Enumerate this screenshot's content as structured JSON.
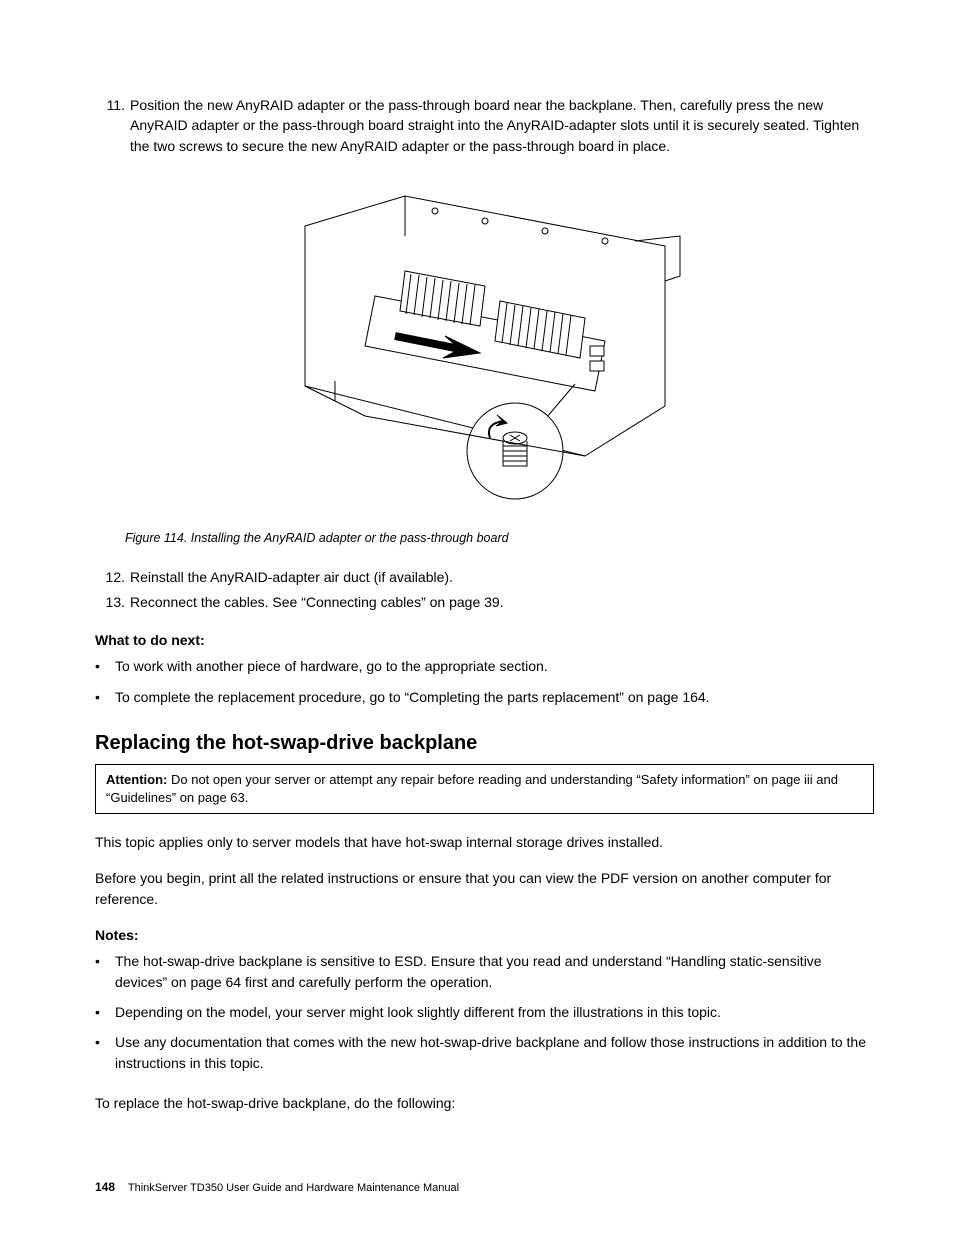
{
  "steps_a": [
    {
      "num": "11.",
      "text": "Position the new AnyRAID adapter or the pass-through board near the backplane. Then, carefully press the new AnyRAID adapter or the pass-through board straight into the AnyRAID-adapter slots until it is securely seated. Tighten the two screws to secure the new AnyRAID adapter or the pass-through board in place."
    }
  ],
  "figure_caption": "Figure 114. Installing the AnyRAID adapter or the pass-through board",
  "steps_b": [
    {
      "num": "12.",
      "text": "Reinstall the AnyRAID-adapter air duct (if available)."
    },
    {
      "num": "13.",
      "text": "Reconnect the cables. See “Connecting cables” on page 39."
    }
  ],
  "what_next_header": "What to do next:",
  "what_next_items": [
    "To work with another piece of hardware, go to the appropriate section.",
    "To complete the replacement procedure, go to “Completing the parts replacement” on page 164."
  ],
  "section_heading": "Replacing the hot-swap-drive backplane",
  "attention_label": "Attention:",
  "attention_text": " Do not open your server or attempt any repair before reading and understanding “Safety information” on page iii and “Guidelines” on page 63.",
  "para1": "This topic applies only to server models that have hot-swap internal storage drives installed.",
  "para2": "Before you begin, print all the related instructions or ensure that you can view the PDF version on another computer for reference.",
  "notes_header": "Notes:",
  "notes_items": [
    "The hot-swap-drive backplane is sensitive to ESD. Ensure that you read and understand “Handling static-sensitive devices” on page 64 first and carefully perform the operation.",
    "Depending on the model, your server might look slightly different from the illustrations in this topic.",
    "Use any documentation that comes with the new hot-swap-drive backplane and follow those instructions in addition to the instructions in this topic."
  ],
  "para3": "To replace the hot-swap-drive backplane, do the following:",
  "footer_page": "148",
  "footer_title": "ThinkServer TD350 User Guide and Hardware Maintenance Manual"
}
